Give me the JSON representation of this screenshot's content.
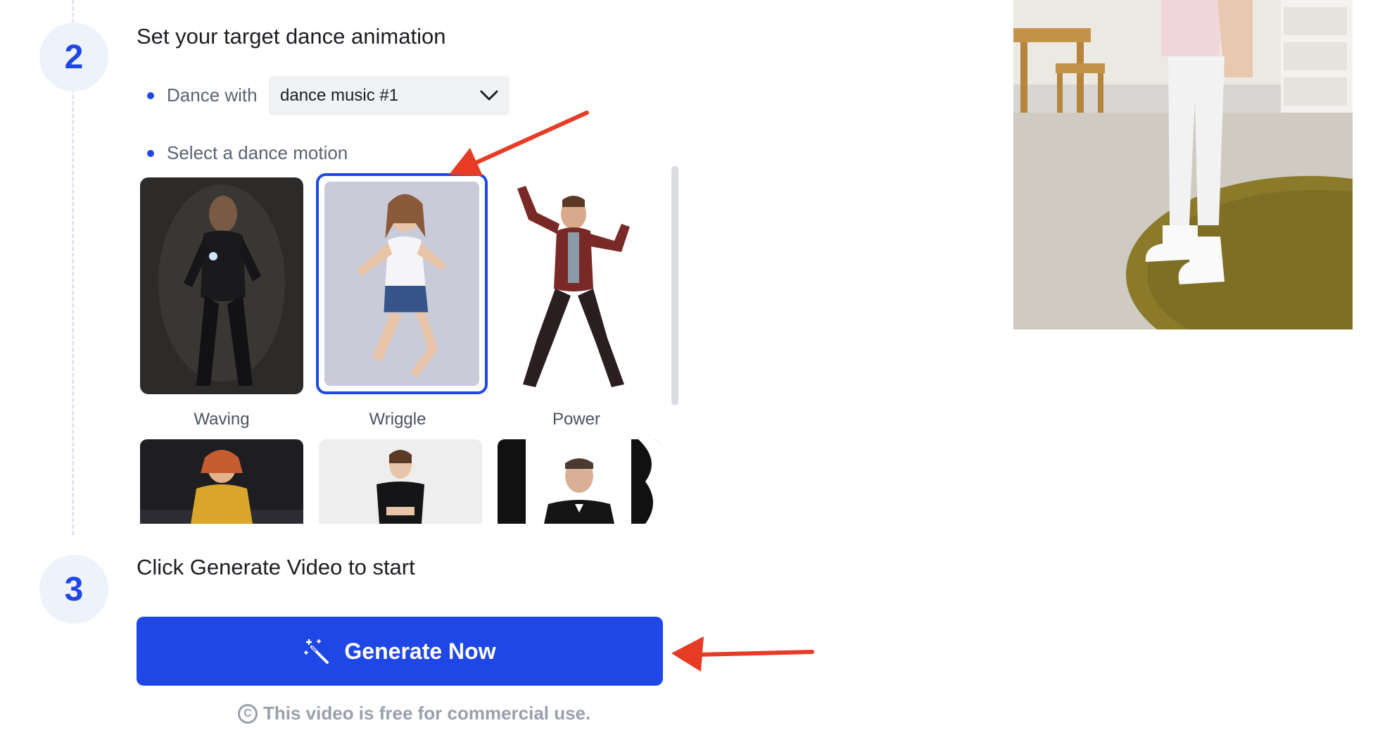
{
  "steps": {
    "step2": {
      "number": "2",
      "title": "Set your target dance animation"
    },
    "step3": {
      "number": "3",
      "title": "Click Generate Video to start"
    }
  },
  "dance_with": {
    "label": "Dance with",
    "selected": "dance music #1",
    "icon": "chevron-down-icon"
  },
  "motion_section": {
    "label": "Select a dance motion",
    "motions": [
      {
        "label": "Waving",
        "selected": false
      },
      {
        "label": "Wriggle",
        "selected": true
      },
      {
        "label": "Power",
        "selected": false
      }
    ]
  },
  "generate": {
    "label": "Generate Now",
    "icon": "magic-wand-icon"
  },
  "note": {
    "text": "This video is free for commercial use.",
    "icon": "copyright-icon"
  },
  "colors": {
    "accent": "#1e47e6",
    "annotation_arrow": "#e63b24"
  }
}
